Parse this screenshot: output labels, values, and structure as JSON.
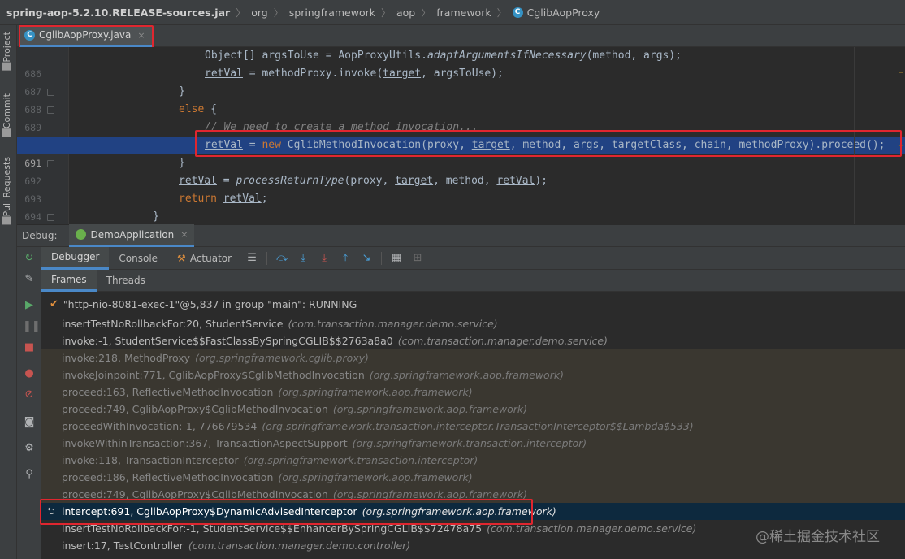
{
  "breadcrumb": [
    "spring-aop-5.2.10.RELEASE-sources.jar",
    "org",
    "springframework",
    "aop",
    "framework",
    "CglibAopProxy"
  ],
  "editor_tab": {
    "label": "CglibAopProxy.java",
    "close": "×"
  },
  "left_strip": {
    "project": "Project",
    "commit": "Commit",
    "pull_requests": "Pull Requests"
  },
  "code": {
    "lines": [
      {
        "num": "686",
        "indent": 0,
        "tokens": []
      },
      {
        "num": "687",
        "indent": 0,
        "tokens": []
      },
      {
        "num": "688",
        "indent": 0,
        "tokens": []
      },
      {
        "num": "689",
        "indent": 0,
        "tokens": []
      },
      {
        "num": "690",
        "indent": 0,
        "tokens": []
      },
      {
        "num": "691",
        "indent": 0,
        "tokens": []
      },
      {
        "num": "692",
        "indent": 0,
        "tokens": []
      },
      {
        "num": "693",
        "indent": 0,
        "tokens": []
      },
      {
        "num": "694",
        "indent": 0,
        "tokens": []
      },
      {
        "num": "695",
        "indent": 0,
        "tokens": []
      }
    ],
    "l686": "Object[] argsToUse = AopProxyUtils.",
    "l686b": "adaptArgumentsIfNecessary",
    "l686c": "(method, args);",
    "l687a": "retVal",
    "l687b": " = methodProxy.invoke(",
    "l687c": "target",
    "l687d": ", argsToUse);",
    "l688": "}",
    "l689a": "else",
    "l689b": " {",
    "l690": "// We need to create a method invocation...",
    "l691a": "retVal",
    "l691b": " = ",
    "l691c": "new",
    "l691d": " CglibMethodInvocation(proxy, ",
    "l691e": "target",
    "l691f": ", method, args, targetClass, chain, methodProxy).proceed();",
    "l692": "}",
    "l693a": "retVal",
    "l693b": " = ",
    "l693c": "processReturnType",
    "l693d": "(proxy, ",
    "l693e": "target",
    "l693f": ", method, ",
    "l693g": "retVal",
    "l693h": ");",
    "l694a": "return",
    "l694b": " ",
    "l694c": "retVal",
    "l694d": ";",
    "l695": "}"
  },
  "debug": {
    "label": "Debug:",
    "session": "DemoApplication",
    "close": "×",
    "tabs": {
      "debugger": "Debugger",
      "console": "Console",
      "actuator": "Actuator"
    },
    "subtabs": {
      "frames": "Frames",
      "threads": "Threads"
    },
    "thread": "\"http-nio-8081-exec-1\"@5,837 in group \"main\": RUNNING",
    "frames": [
      {
        "method": "insertTestNoRollbackFor:20, StudentService",
        "pkg": "(com.transaction.manager.demo.service)",
        "kind": "user"
      },
      {
        "method": "invoke:-1, StudentService$$FastClassBySpringCGLIB$$2763a8a0",
        "pkg": "(com.transaction.manager.demo.service)",
        "kind": "user"
      },
      {
        "method": "invoke:218, MethodProxy",
        "pkg": "(org.springframework.cglib.proxy)",
        "kind": "lib"
      },
      {
        "method": "invokeJoinpoint:771, CglibAopProxy$CglibMethodInvocation",
        "pkg": "(org.springframework.aop.framework)",
        "kind": "lib"
      },
      {
        "method": "proceed:163, ReflectiveMethodInvocation",
        "pkg": "(org.springframework.aop.framework)",
        "kind": "lib"
      },
      {
        "method": "proceed:749, CglibAopProxy$CglibMethodInvocation",
        "pkg": "(org.springframework.aop.framework)",
        "kind": "lib"
      },
      {
        "method": "proceedWithInvocation:-1, 776679534",
        "pkg": "(org.springframework.transaction.interceptor.TransactionInterceptor$$Lambda$533)",
        "kind": "lib"
      },
      {
        "method": "invokeWithinTransaction:367, TransactionAspectSupport",
        "pkg": "(org.springframework.transaction.interceptor)",
        "kind": "lib"
      },
      {
        "method": "invoke:118, TransactionInterceptor",
        "pkg": "(org.springframework.transaction.interceptor)",
        "kind": "lib"
      },
      {
        "method": "proceed:186, ReflectiveMethodInvocation",
        "pkg": "(org.springframework.aop.framework)",
        "kind": "lib"
      },
      {
        "method": "proceed:749, CglibAopProxy$CglibMethodInvocation",
        "pkg": "(org.springframework.aop.framework)",
        "kind": "lib"
      },
      {
        "method": "intercept:691, CglibAopProxy$DynamicAdvisedInterceptor",
        "pkg": "(org.springframework.aop.framework)",
        "kind": "selected"
      },
      {
        "method": "insertTestNoRollbackFor:-1, StudentService$$EnhancerBySpringCGLIB$$72478a75",
        "pkg": "(com.transaction.manager.demo.service)",
        "kind": "user"
      },
      {
        "method": "insert:17, TestController",
        "pkg": "(com.transaction.manager.demo.controller)",
        "kind": "user"
      }
    ]
  },
  "watermark": "@稀土掘金技术社区",
  "colors": {
    "accent": "#4a88c7",
    "highlight_box": "#e0262f",
    "current_line": "#214283",
    "selected_frame": "#0d293e"
  }
}
